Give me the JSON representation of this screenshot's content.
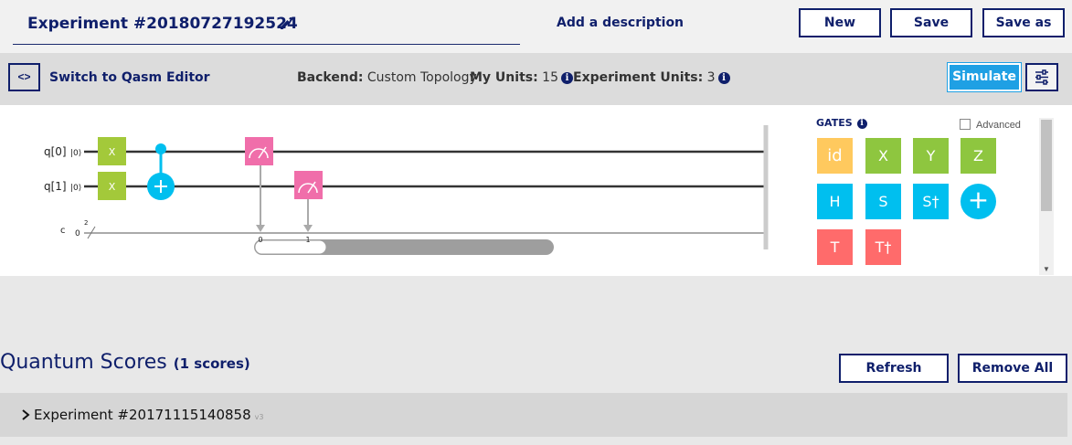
{
  "header": {
    "title": "Experiment #20180727192524",
    "add_description": "Add a description",
    "buttons": {
      "new": "New",
      "save": "Save",
      "save_as": "Save as"
    }
  },
  "toolbar": {
    "switch_icon": "<>",
    "switch_label": "Switch to Qasm Editor",
    "backend_label": "Backend:",
    "backend_value": "Custom Topology",
    "my_units_label": "My Units:",
    "my_units_value": "15",
    "experiment_units_label": "Experiment Units:",
    "experiment_units_value": "3",
    "simulate": "Simulate",
    "settings_icon": "sliders-icon"
  },
  "circuit": {
    "qubits": [
      {
        "label": "q[0]",
        "init": "|0⟩"
      },
      {
        "label": "q[1]",
        "init": "|0⟩"
      }
    ],
    "classical": {
      "label": "c",
      "init": "0",
      "width": "2"
    },
    "ops": {
      "x0": "X",
      "x1": "X",
      "measure_bit0": "0",
      "measure_bit1": "1"
    }
  },
  "gates": {
    "title": "GATES",
    "advanced": "Advanced",
    "palette": [
      {
        "label": "id",
        "color": "#ffc95e"
      },
      {
        "label": "X",
        "color": "#8ec63f"
      },
      {
        "label": "Y",
        "color": "#8ec63f"
      },
      {
        "label": "Z",
        "color": "#8ec63f"
      },
      {
        "label": "H",
        "color": "#00bfef"
      },
      {
        "label": "S",
        "color": "#00bfef"
      },
      {
        "label": "S†",
        "color": "#00bfef"
      },
      {
        "label": "+",
        "color": "#00bfef"
      },
      {
        "label": "T",
        "color": "#ff6b6b"
      },
      {
        "label": "T†",
        "color": "#ff6b6b"
      }
    ]
  },
  "scores": {
    "title": "Quantum Scores",
    "count": "(1 scores)",
    "refresh": "Refresh",
    "remove_all": "Remove All",
    "items": [
      {
        "name": "Experiment #20171115140858",
        "sub": "v3"
      }
    ]
  }
}
